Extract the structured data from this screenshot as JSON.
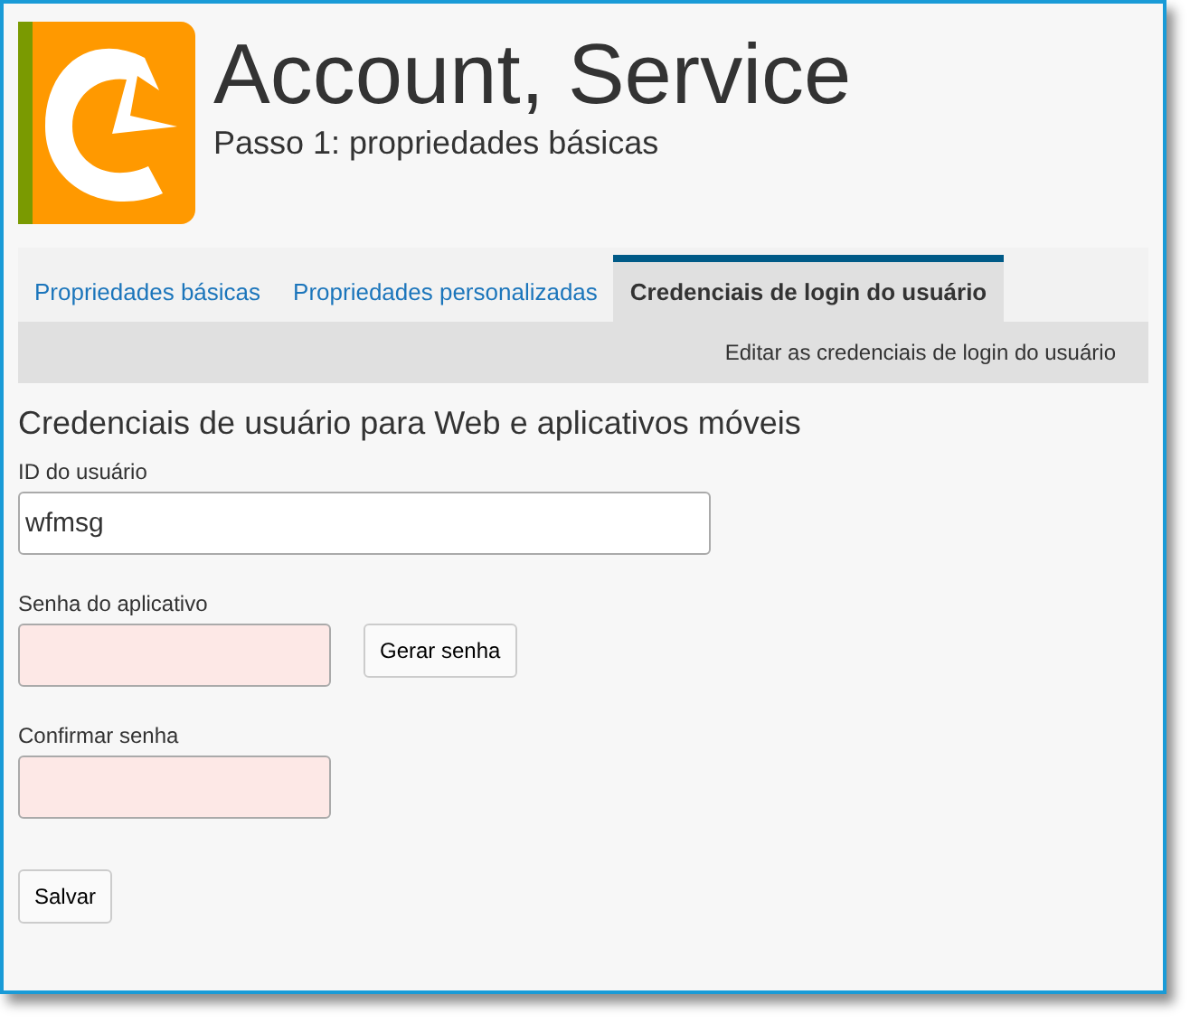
{
  "header": {
    "title": "Account, Service",
    "subtitle": "Passo 1: propriedades básicas"
  },
  "tabs": [
    {
      "label": "Propriedades básicas",
      "selected": false
    },
    {
      "label": "Propriedades personalizadas",
      "selected": false
    },
    {
      "label": "Credenciais de login do usuário",
      "selected": true
    }
  ],
  "action_bar": {
    "link": "Editar as credenciais de login do usuário"
  },
  "section": {
    "heading": "Credenciais de usuário para Web e aplicativos móveis"
  },
  "fields": [
    {
      "label": "ID do usuário",
      "value": "wfmsg",
      "invalid": false
    },
    {
      "label": "Senha do aplicativo",
      "invalid": true,
      "button": "Gerar senha"
    },
    {
      "label": "Confirmar senha",
      "invalid": true
    }
  ],
  "buttons": [
    "Salvar"
  ]
}
